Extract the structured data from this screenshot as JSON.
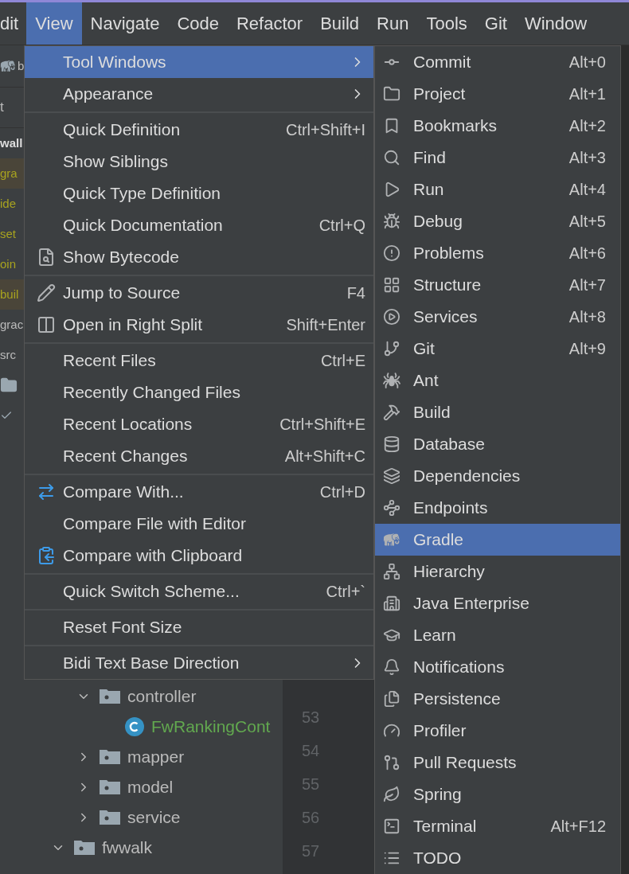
{
  "menu_bar": [
    {
      "label": "dit",
      "selected": false
    },
    {
      "label": "View",
      "selected": true
    },
    {
      "label": "Navigate",
      "selected": false
    },
    {
      "label": "Code",
      "selected": false
    },
    {
      "label": "Refactor",
      "selected": false
    },
    {
      "label": "Build",
      "selected": false
    },
    {
      "label": "Run",
      "selected": false
    },
    {
      "label": "Tools",
      "selected": false
    },
    {
      "label": "Git",
      "selected": false
    },
    {
      "label": "Window",
      "selected": false
    }
  ],
  "left_fragments": [
    {
      "kind": "toolbar",
      "text": "b"
    },
    {
      "kind": "tab",
      "text": "t"
    },
    {
      "kind": "bold",
      "text": "wall"
    },
    {
      "kind": "warn_bg",
      "text": "gra"
    },
    {
      "kind": "warn",
      "text": "ide"
    },
    {
      "kind": "warn",
      "text": "set"
    },
    {
      "kind": "warn",
      "text": "oin"
    },
    {
      "kind": "warn_bg",
      "text": "buil"
    },
    {
      "kind": "plain",
      "text": "grac"
    },
    {
      "kind": "plain",
      "text": "src"
    },
    {
      "kind": "folder_icon"
    },
    {
      "kind": "check_icon"
    }
  ],
  "project_tree": [
    {
      "children": [
        {
          "label": "controller",
          "kind": "folder",
          "expanded": true,
          "children": [
            {
              "label": "FwRankingCont",
              "kind": "class"
            }
          ]
        },
        {
          "label": "mapper",
          "kind": "folder",
          "expanded": false
        },
        {
          "label": "model",
          "kind": "folder",
          "expanded": false
        },
        {
          "label": "service",
          "kind": "folder",
          "expanded": false
        }
      ]
    },
    {
      "label": "fwwalk",
      "kind": "folder",
      "expanded": true
    }
  ],
  "line_numbers": [
    "53",
    "54",
    "55",
    "56",
    "57"
  ],
  "view_menu": [
    {
      "kind": "item",
      "label": "Tool Windows",
      "submenu": true,
      "selected": true
    },
    {
      "kind": "item",
      "label": "Appearance",
      "submenu": true,
      "selected": false
    },
    {
      "kind": "separator"
    },
    {
      "kind": "item",
      "label": "Quick Definition",
      "shortcut": "Ctrl+Shift+I",
      "selected": false
    },
    {
      "kind": "item",
      "label": "Show Siblings",
      "selected": false
    },
    {
      "kind": "item",
      "label": "Quick Type Definition",
      "selected": false
    },
    {
      "kind": "item",
      "label": "Quick Documentation",
      "shortcut": "Ctrl+Q",
      "selected": false
    },
    {
      "kind": "item",
      "label": "Show Bytecode",
      "selected": false
    },
    {
      "kind": "separator"
    },
    {
      "kind": "item",
      "label": "Jump to Source",
      "shortcut": "F4",
      "selected": false
    },
    {
      "kind": "item",
      "label": "Open in Right Split",
      "shortcut": "Shift+Enter",
      "selected": false
    },
    {
      "kind": "separator"
    },
    {
      "kind": "item",
      "label": "Recent Files",
      "shortcut": "Ctrl+E",
      "selected": false
    },
    {
      "kind": "item",
      "label": "Recently Changed Files",
      "selected": false
    },
    {
      "kind": "item",
      "label": "Recent Locations",
      "shortcut": "Ctrl+Shift+E",
      "selected": false
    },
    {
      "kind": "item",
      "label": "Recent Changes",
      "shortcut": "Alt+Shift+C",
      "selected": false
    },
    {
      "kind": "separator"
    },
    {
      "kind": "item",
      "label": "Compare With...",
      "shortcut": "Ctrl+D",
      "selected": false
    },
    {
      "kind": "item",
      "label": "Compare File with Editor",
      "selected": false
    },
    {
      "kind": "item",
      "label": "Compare with Clipboard",
      "selected": false
    },
    {
      "kind": "separator"
    },
    {
      "kind": "item",
      "label": "Quick Switch Scheme...",
      "shortcut": "Ctrl+`",
      "selected": false
    },
    {
      "kind": "separator"
    },
    {
      "kind": "item",
      "label": "Reset Font Size",
      "selected": false
    },
    {
      "kind": "separator"
    },
    {
      "kind": "item",
      "label": "Bidi Text Base Direction",
      "submenu": true,
      "selected": false
    }
  ],
  "tool_windows_menu": [
    {
      "label": "Commit",
      "shortcut": "Alt+0",
      "selected": false
    },
    {
      "label": "Project",
      "shortcut": "Alt+1",
      "selected": false
    },
    {
      "label": "Bookmarks",
      "shortcut": "Alt+2",
      "selected": false
    },
    {
      "label": "Find",
      "shortcut": "Alt+3",
      "selected": false
    },
    {
      "label": "Run",
      "shortcut": "Alt+4",
      "selected": false
    },
    {
      "label": "Debug",
      "shortcut": "Alt+5",
      "selected": false
    },
    {
      "label": "Problems",
      "shortcut": "Alt+6",
      "selected": false
    },
    {
      "label": "Structure",
      "shortcut": "Alt+7",
      "selected": false
    },
    {
      "label": "Services",
      "shortcut": "Alt+8",
      "selected": false
    },
    {
      "label": "Git",
      "shortcut": "Alt+9",
      "selected": false
    },
    {
      "label": "Ant",
      "selected": false
    },
    {
      "label": "Build",
      "selected": false
    },
    {
      "label": "Database",
      "selected": false
    },
    {
      "label": "Dependencies",
      "selected": false
    },
    {
      "label": "Endpoints",
      "selected": false
    },
    {
      "label": "Gradle",
      "selected": true
    },
    {
      "label": "Hierarchy",
      "selected": false
    },
    {
      "label": "Java Enterprise",
      "selected": false
    },
    {
      "label": "Learn",
      "selected": false
    },
    {
      "label": "Notifications",
      "selected": false
    },
    {
      "label": "Persistence",
      "selected": false
    },
    {
      "label": "Profiler",
      "selected": false
    },
    {
      "label": "Pull Requests",
      "selected": false
    },
    {
      "label": "Spring",
      "selected": false
    },
    {
      "label": "Terminal",
      "shortcut": "Alt+F12",
      "selected": false
    },
    {
      "label": "TODO",
      "selected": false
    }
  ]
}
